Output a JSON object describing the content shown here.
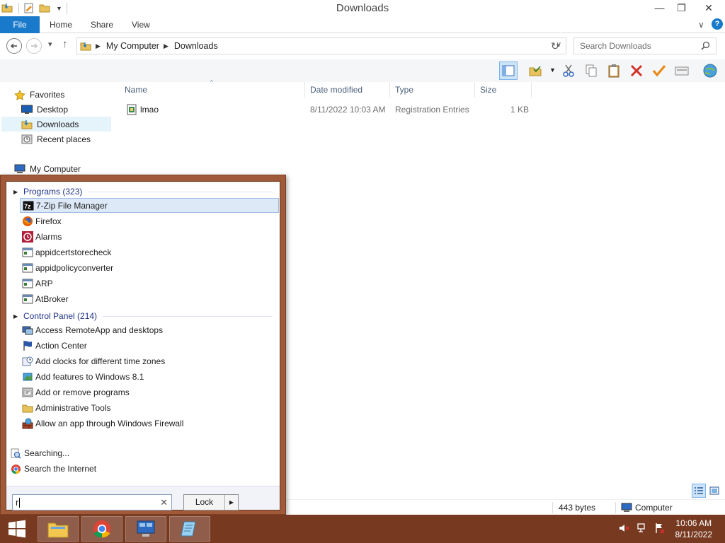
{
  "window": {
    "title": "Downloads",
    "minimize": "—",
    "restore": "❐",
    "close": "✕",
    "collapse_ribbon": "∨",
    "help": "?"
  },
  "ribbon_tabs": [
    "File",
    "Home",
    "Share",
    "View"
  ],
  "address": {
    "crumbs": [
      "My Computer",
      "Downloads"
    ],
    "search_placeholder": "Search Downloads"
  },
  "nav_pane": {
    "favorites_label": "Favorites",
    "items": [
      "Desktop",
      "Downloads",
      "Recent places"
    ],
    "computer_label": "My Computer"
  },
  "file_list": {
    "columns": [
      "Name",
      "Date modified",
      "Type",
      "Size"
    ],
    "rows": [
      {
        "name": "lmao",
        "date": "8/11/2022 10:03 AM",
        "type": "Registration Entries",
        "size": "1 KB"
      }
    ]
  },
  "status_bar": {
    "size": "443 bytes",
    "location": "Computer"
  },
  "start_menu": {
    "programs_header": "Programs (323)",
    "programs": [
      "7-Zip File Manager",
      "Firefox",
      "Alarms",
      "appidcertstorecheck",
      "appidpolicyconverter",
      "ARP",
      "AtBroker"
    ],
    "control_panel_header": "Control Panel (214)",
    "control_panel": [
      "Access RemoteApp and desktops",
      "Action Center",
      "Add clocks for different time zones",
      "Add features to Windows 8.1",
      "Add or remove programs",
      "Administrative Tools",
      "Allow an app through Windows Firewall"
    ],
    "searching_label": "Searching...",
    "search_internet_label": "Search the Internet",
    "search_value": "r",
    "clear": "✕",
    "lock_label": "Lock"
  },
  "taskbar": {
    "time": "10:06 AM",
    "date": "8/11/2022"
  },
  "colors": {
    "accent": "#1979ca",
    "start_menu_frame": "#a05a3a",
    "taskbar": "#773a21",
    "group_header_text": "#1e3287"
  }
}
